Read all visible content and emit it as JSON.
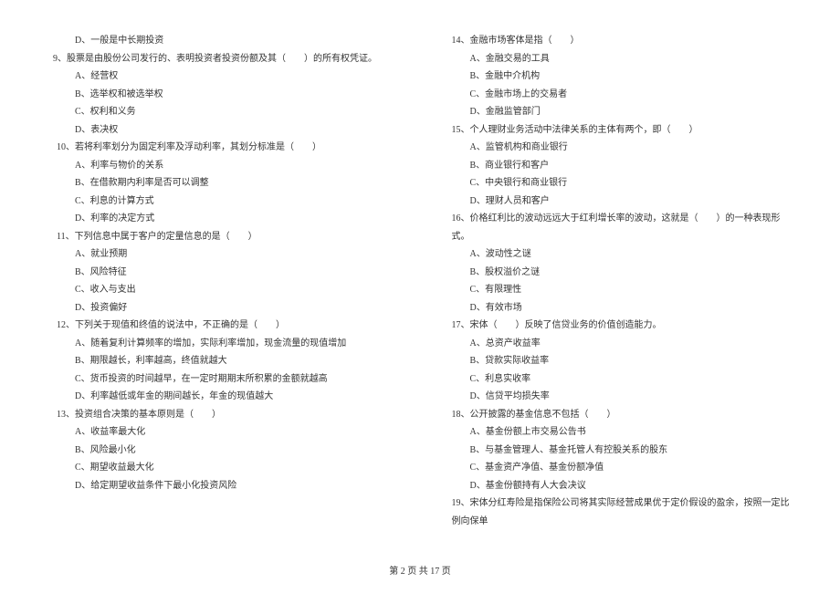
{
  "left_column": {
    "items": [
      {
        "cls": "option",
        "text": "D、一般是中长期投资"
      },
      {
        "cls": "question-9",
        "text": "9、股票是由股份公司发行的、表明投资者投资份额及其（　　）的所有权凭证。"
      },
      {
        "cls": "option",
        "text": "A、经营权"
      },
      {
        "cls": "option",
        "text": "B、选举权和被选举权"
      },
      {
        "cls": "option",
        "text": "C、权利和义务"
      },
      {
        "cls": "option",
        "text": "D、表决权"
      },
      {
        "cls": "question",
        "text": "10、若将利率划分为固定利率及浮动利率，其划分标准是（　　）"
      },
      {
        "cls": "option",
        "text": "A、利率与物价的关系"
      },
      {
        "cls": "option",
        "text": "B、在借款期内利率是否可以调整"
      },
      {
        "cls": "option",
        "text": "C、利息的计算方式"
      },
      {
        "cls": "option",
        "text": "D、利率的决定方式"
      },
      {
        "cls": "question",
        "text": "11、下列信息中属于客户的定量信息的是（　　）"
      },
      {
        "cls": "option",
        "text": "A、就业预期"
      },
      {
        "cls": "option",
        "text": "B、风险特征"
      },
      {
        "cls": "option",
        "text": "C、收入与支出"
      },
      {
        "cls": "option",
        "text": "D、投资偏好"
      },
      {
        "cls": "question",
        "text": "12、下列关于现值和终值的说法中，不正确的是（　　）"
      },
      {
        "cls": "option",
        "text": "A、随着复利计算频率的增加，实际利率增加，现金流量的现值增加"
      },
      {
        "cls": "option",
        "text": "B、期限越长，利率越高，终值就越大"
      },
      {
        "cls": "option",
        "text": "C、货币投资的时间越早，在一定时期期末所积累的金额就越高"
      },
      {
        "cls": "option",
        "text": "D、利率越低或年金的期间越长，年金的现值越大"
      },
      {
        "cls": "question",
        "text": "13、投资组合决策的基本原则是（　　）"
      },
      {
        "cls": "option",
        "text": "A、收益率最大化"
      },
      {
        "cls": "option",
        "text": "B、风险最小化"
      },
      {
        "cls": "option",
        "text": "C、期望收益最大化"
      },
      {
        "cls": "option",
        "text": "D、给定期望收益条件下最小化投资风险"
      }
    ]
  },
  "right_column": {
    "items": [
      {
        "cls": "question",
        "text": "14、金融市场客体是指（　　）"
      },
      {
        "cls": "option",
        "text": "A、金融交易的工具"
      },
      {
        "cls": "option",
        "text": "B、金融中介机构"
      },
      {
        "cls": "option",
        "text": "C、金融市场上的交易者"
      },
      {
        "cls": "option",
        "text": "D、金融监管部门"
      },
      {
        "cls": "question",
        "text": "15、个人理财业务活动中法律关系的主体有两个，即（　　）"
      },
      {
        "cls": "option",
        "text": "A、监管机构和商业银行"
      },
      {
        "cls": "option",
        "text": "B、商业银行和客户"
      },
      {
        "cls": "option",
        "text": "C、中央银行和商业银行"
      },
      {
        "cls": "option",
        "text": "D、理财人员和客户"
      },
      {
        "cls": "question",
        "text": "16、价格红利比的波动远远大于红利增长率的波动，这就是（　　）的一种表现形式。"
      },
      {
        "cls": "option",
        "text": "A、波动性之谜"
      },
      {
        "cls": "option",
        "text": "B、股权溢价之谜"
      },
      {
        "cls": "option",
        "text": "C、有限理性"
      },
      {
        "cls": "option",
        "text": "D、有效市场"
      },
      {
        "cls": "question",
        "text": "17、宋体（　　）反映了信贷业务的价值创造能力。"
      },
      {
        "cls": "option",
        "text": "A、总资产收益率"
      },
      {
        "cls": "option",
        "text": "B、贷款实际收益率"
      },
      {
        "cls": "option",
        "text": "C、利息实收率"
      },
      {
        "cls": "option",
        "text": "D、信贷平均损失率"
      },
      {
        "cls": "question",
        "text": "18、公开披露的基金信息不包括（　　）"
      },
      {
        "cls": "option",
        "text": "A、基金份额上市交易公告书"
      },
      {
        "cls": "option",
        "text": "B、与基金管理人、基金托管人有控股关系的股东"
      },
      {
        "cls": "option",
        "text": "C、基金资产净值、基金份额净值"
      },
      {
        "cls": "option",
        "text": "D、基金份额持有人大会决议"
      },
      {
        "cls": "question",
        "text": "19、宋体分红寿险是指保险公司将其实际经营成果优于定价假设的盈余，按照一定比例向保单"
      }
    ]
  },
  "footer": "第 2 页 共 17 页"
}
